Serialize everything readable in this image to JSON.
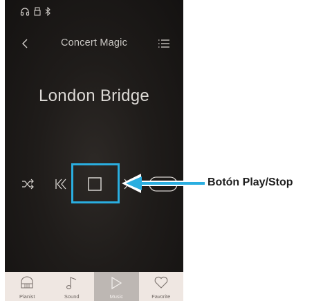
{
  "status_bar": {
    "icons": [
      "headphones-icon",
      "usb-icon",
      "bluetooth-icon"
    ]
  },
  "nav": {
    "back_icon": "chevron-left-icon",
    "title": "Concert Magic",
    "menu_icon": "list-icon"
  },
  "song": {
    "title": "London Bridge"
  },
  "controls": {
    "items": [
      "shuffle-icon",
      "skip-back-icon",
      "stop-icon",
      "skip-forward-icon",
      "toggle-icon"
    ]
  },
  "tabs": [
    {
      "label": "Pianist",
      "icon": "piano-icon",
      "active": false
    },
    {
      "label": "Sound",
      "icon": "music-note-icon",
      "active": false
    },
    {
      "label": "Music",
      "icon": "play-icon",
      "active": true
    },
    {
      "label": "Favorite",
      "icon": "heart-icon",
      "active": false
    }
  ],
  "callout": {
    "label": "Botón Play/Stop",
    "color": "#2aaee0"
  },
  "colors": {
    "tab_bar": "#efe7e2",
    "tab_active": "#bdb7b3",
    "highlight": "#2aaee0"
  }
}
